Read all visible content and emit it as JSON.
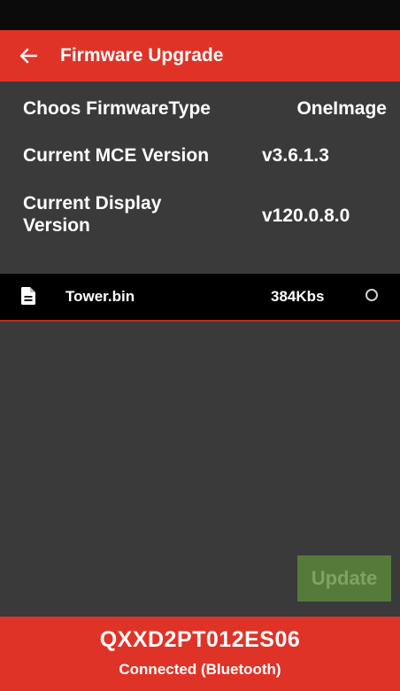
{
  "header": {
    "title": "Firmware Upgrade",
    "back_icon": "arrow-left-icon"
  },
  "info": {
    "firmware_type_label": "Choos FirmwareType",
    "firmware_type_value": "OneImage",
    "mce_label": "Current MCE Version",
    "mce_value": "v3.6.1.3",
    "display_label_line1": "Current Display",
    "display_label_line2": "Version",
    "display_value": "v120.0.8.0"
  },
  "files": [
    {
      "icon": "file-document-icon",
      "name": "Tower.bin",
      "size": "384Kbs",
      "selected": false
    }
  ],
  "actions": {
    "update_label": "Update"
  },
  "footer": {
    "device_id": "QXXD2PT012ES06",
    "status": "Connected (Bluetooth)"
  },
  "colors": {
    "accent": "#e03327",
    "background": "#3a3a3a",
    "update_button": "#557b3a"
  }
}
